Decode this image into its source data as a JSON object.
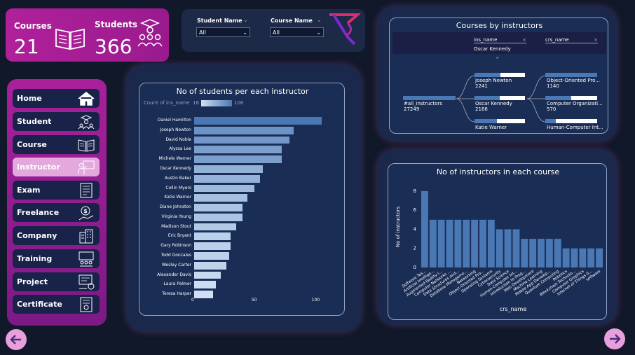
{
  "kpi": {
    "courses_label": "Courses",
    "courses_value": "21",
    "students_label": "Students",
    "students_value": "366"
  },
  "filters": {
    "student_label": "Student Name",
    "student_value": "All",
    "course_label": "Course Name",
    "course_value": "All"
  },
  "nav": {
    "items": [
      {
        "label": "Home",
        "icon": "home-icon"
      },
      {
        "label": "Student",
        "icon": "students-icon"
      },
      {
        "label": "Course",
        "icon": "book-icon"
      },
      {
        "label": "Instructor",
        "icon": "instructor-icon"
      },
      {
        "label": "Exam",
        "icon": "exam-icon"
      },
      {
        "label": "Freelance",
        "icon": "freelance-icon"
      },
      {
        "label": "Company",
        "icon": "building-icon"
      },
      {
        "label": "Training",
        "icon": "training-icon"
      },
      {
        "label": "Project",
        "icon": "project-icon"
      },
      {
        "label": "Certificate",
        "icon": "certificate-icon"
      }
    ],
    "active": "Instructor"
  },
  "students_chart": {
    "title": "No of students per each instructor",
    "legend_label": "Count of ins_name",
    "legend_min": "16",
    "legend_max": "106"
  },
  "tree": {
    "title": "Courses by instructors",
    "filter1_label": "ins_name",
    "filter1_value": "Oscar Kennedy",
    "filter2_label": "crs_name",
    "root_label": "#all_instructors",
    "root_value": "27249",
    "level1": [
      {
        "name": "Joseph Newton",
        "value": "2241"
      },
      {
        "name": "Oscar Kennedy",
        "value": "2166"
      },
      {
        "name": "Katie Warner",
        "value": ""
      }
    ],
    "level2": [
      {
        "name": "Object-Oriented Pro...",
        "value": "1140"
      },
      {
        "name": "Computer Organizati...",
        "value": "570"
      },
      {
        "name": "Human-Computer Int...",
        "value": ""
      }
    ]
  },
  "courses_chart": {
    "title": "No of instructors in each course"
  },
  "chart_data": [
    {
      "type": "bar",
      "orientation": "horizontal",
      "title": "No of students per each instructor",
      "categories": [
        "Daniel Hamilton",
        "Joseph Newton",
        "David Noble",
        "Alyssa Lee",
        "Michele Werner",
        "Oscar Kennedy",
        "Austin Baker",
        "Collin Myers",
        "Katie Warner",
        "Diane Johnston",
        "Virginia Young",
        "Madison Stout",
        "Eric Bryant",
        "Gary Robinson",
        "Todd Gonzales",
        "Wesley Carter",
        "Alexander Davis",
        "Laura Palmer",
        "Teresa Harper"
      ],
      "values": [
        106,
        83,
        79,
        73,
        73,
        57,
        55,
        50,
        44,
        40,
        40,
        35,
        30,
        30,
        29,
        27,
        22,
        18,
        16
      ],
      "xticks": [
        "0",
        "50",
        "100"
      ],
      "xlim": [
        0,
        120
      ],
      "colors": {
        "min": "#cfe0f5",
        "max": "#4a78b4"
      }
    },
    {
      "type": "bar",
      "title": "No of instructors in each course",
      "xlabel": "crs_name",
      "ylabel": "No of instructors",
      "categories": [
        "Software Tes...",
        "Artificial Intellige...",
        "Augmented Reality (...",
        "Computer Networks ...",
        "Data Structures and...",
        "Database Manageme...",
        "Networking",
        "Object-Oriented Pro...",
        "Operating Systems",
        "Cybersecurity",
        "Data Science",
        "Human-Computer Int...",
        "Introduction to Prog...",
        "Web Development",
        "Machine Learning",
        "Mobile App Develop...",
        "Quantum Computing",
        "Robotics",
        "Blockchain Technolo...",
        "Computer Graphics",
        "Internet of Things (l...",
        "software"
      ],
      "values": [
        8,
        5,
        5,
        5,
        5,
        5,
        5,
        5,
        5,
        4,
        4,
        4,
        3,
        3,
        3,
        3,
        3,
        2,
        2,
        2,
        2,
        2
      ],
      "yticks": [
        "0",
        "2",
        "4",
        "6",
        "8"
      ],
      "ylim": [
        0,
        8.8
      ],
      "color": "#4a78b4"
    }
  ]
}
